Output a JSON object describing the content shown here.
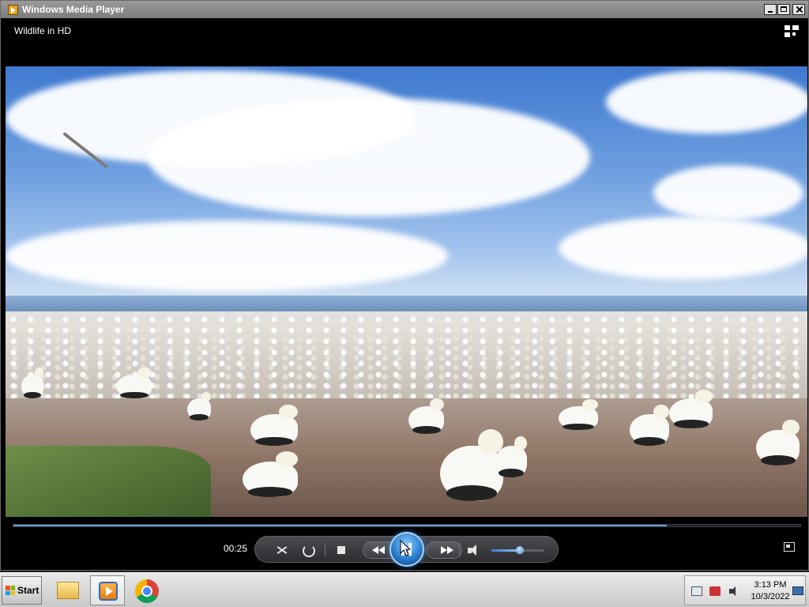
{
  "window": {
    "title": "Windows Media Player"
  },
  "player": {
    "media_title": "Wildlife in HD",
    "elapsed_time": "00:25",
    "progress_fraction": 0.83,
    "volume_fraction": 0.55,
    "state": "playing"
  },
  "icons": {
    "app": "windows-media-player-icon",
    "switch_to_library": "switch-to-library-icon",
    "shuffle": "shuffle-icon",
    "repeat": "repeat-icon",
    "stop": "stop-icon",
    "previous": "previous-icon",
    "pause": "pause-icon",
    "next": "next-icon",
    "volume": "speaker-icon",
    "fullscreen": "fullscreen-icon"
  },
  "taskbar": {
    "start_label": "Start",
    "apps": [
      "file-explorer",
      "windows-media-player",
      "google-chrome"
    ],
    "clock_time": "3:13 PM",
    "clock_date": "10/3/2022"
  },
  "colors": {
    "accent": "#2a7fd0",
    "titlebar": "#8a8a8a",
    "background": "#000000"
  }
}
